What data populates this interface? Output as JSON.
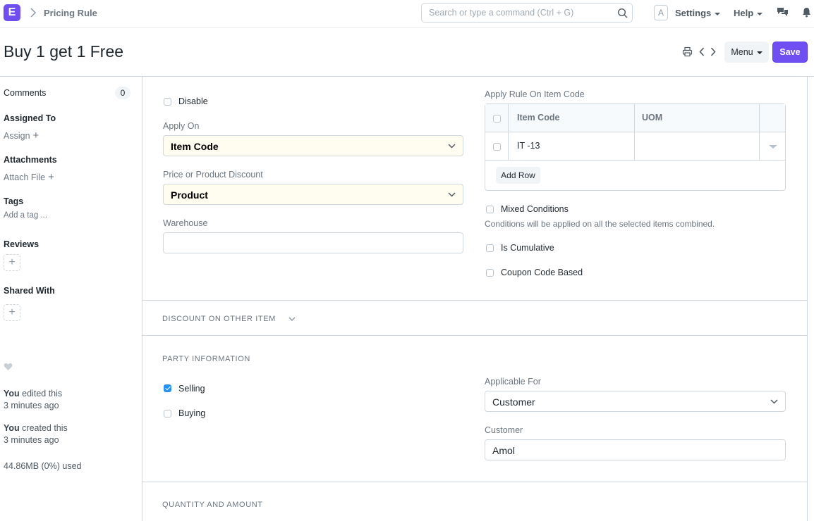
{
  "navbar": {
    "logo_letter": "E",
    "breadcrumb": "Pricing Rule",
    "search_placeholder": "Search or type a command (Ctrl + G)",
    "avatar_letter": "A",
    "settings": "Settings",
    "help": "Help"
  },
  "page": {
    "title": "Buy 1 get 1 Free",
    "menu_label": "Menu",
    "save_label": "Save"
  },
  "sidebar": {
    "comments": "Comments",
    "comments_count": "0",
    "assigned_to": "Assigned To",
    "assign": "Assign",
    "attachments": "Attachments",
    "attach_file": "Attach File",
    "tags": "Tags",
    "add_tag": "Add a tag ...",
    "reviews": "Reviews",
    "shared_with": "Shared With",
    "edited_by": "You",
    "edited_text": "edited this",
    "edited_time": "3 minutes ago",
    "created_by": "You",
    "created_text": "created this",
    "created_time": "3 minutes ago",
    "storage": "44.86MB (0%) used"
  },
  "form": {
    "disable_label": "Disable",
    "disable_checked": false,
    "apply_on_label": "Apply On",
    "apply_on_value": "Item Code",
    "price_or_product_label": "Price or Product Discount",
    "price_or_product_value": "Product",
    "warehouse_label": "Warehouse",
    "warehouse_value": "",
    "apply_rule_label": "Apply Rule On Item Code",
    "table": {
      "columns": [
        "Item Code",
        "UOM"
      ],
      "rows": [
        {
          "item_code": "IT -13",
          "uom": ""
        }
      ],
      "add_row": "Add Row"
    },
    "mixed_conditions_label": "Mixed Conditions",
    "mixed_conditions_help": "Conditions will be applied on all the selected items combined.",
    "is_cumulative_label": "Is Cumulative",
    "coupon_code_label": "Coupon Code Based"
  },
  "sections": {
    "discount_other_item": "DISCOUNT ON OTHER ITEM",
    "party_information": "PARTY INFORMATION",
    "quantity_amount": "QUANTITY AND AMOUNT"
  },
  "party": {
    "selling_label": "Selling",
    "selling_checked": true,
    "buying_label": "Buying",
    "buying_checked": false,
    "applicable_for_label": "Applicable For",
    "applicable_for_value": "Customer",
    "customer_label": "Customer",
    "customer_value": "Amol"
  },
  "colors": {
    "accent": "#6f4ef2",
    "checkbox_checked": "#2490ef"
  }
}
